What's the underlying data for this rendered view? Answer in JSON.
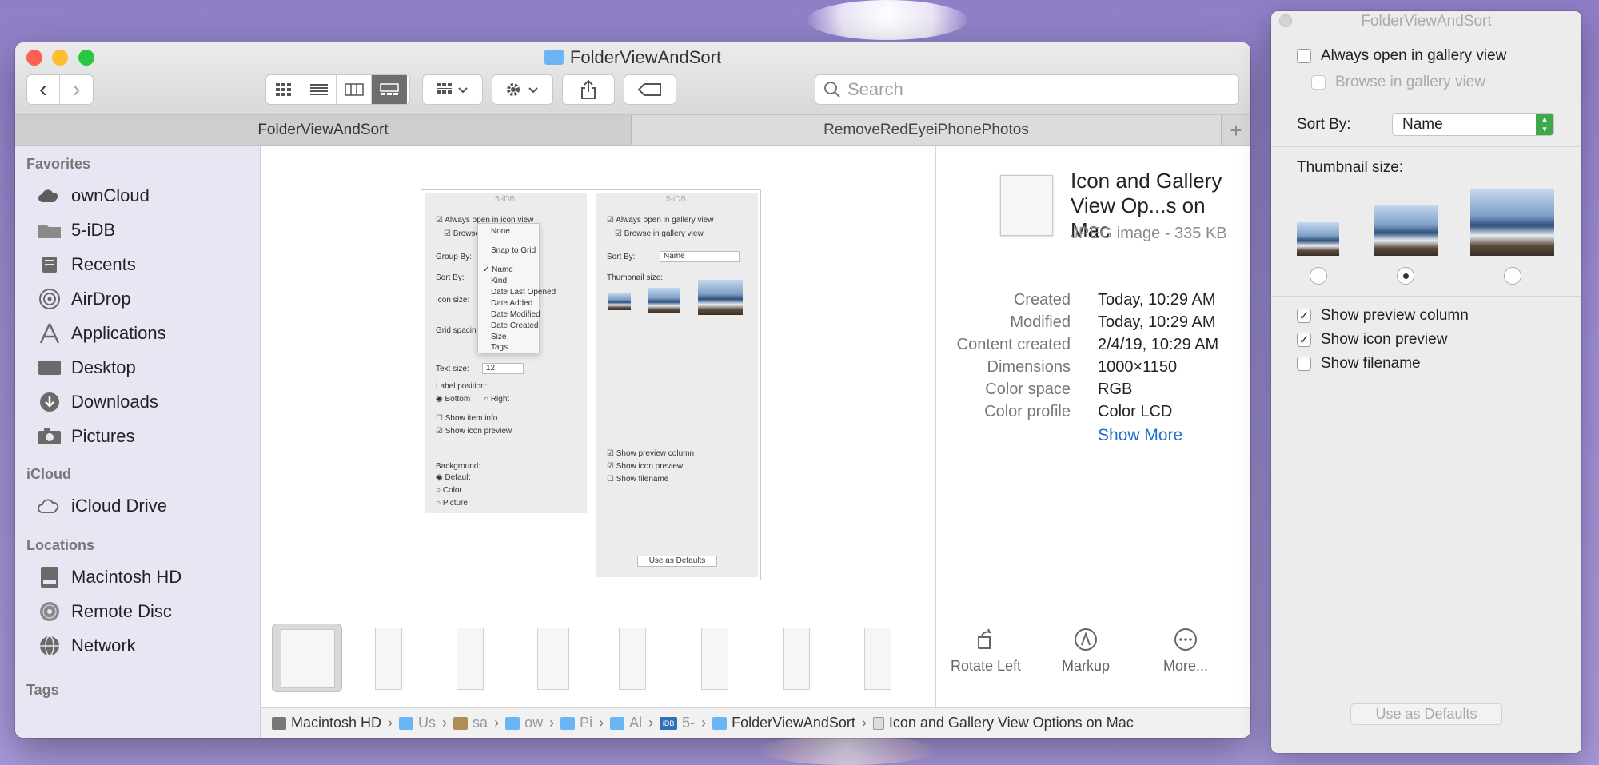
{
  "finder": {
    "title": "FolderViewAndSort",
    "search_placeholder": "Search",
    "tabs": [
      "FolderViewAndSort",
      "RemoveRedEyeiPhonePhotos"
    ],
    "add_tab": "+",
    "back": "‹",
    "forward": "›"
  },
  "sidebar": {
    "favorites_heading": "Favorites",
    "favorites": [
      {
        "label": "ownCloud",
        "icon": "cloud-icon"
      },
      {
        "label": "5-iDB",
        "icon": "folder-icon"
      },
      {
        "label": "Recents",
        "icon": "recents-icon"
      },
      {
        "label": "AirDrop",
        "icon": "airdrop-icon"
      },
      {
        "label": "Applications",
        "icon": "applications-icon"
      },
      {
        "label": "Desktop",
        "icon": "desktop-icon"
      },
      {
        "label": "Downloads",
        "icon": "downloads-icon"
      },
      {
        "label": "Pictures",
        "icon": "pictures-icon"
      }
    ],
    "icloud_heading": "iCloud",
    "icloud": [
      {
        "label": "iCloud Drive",
        "icon": "icloud-icon"
      }
    ],
    "locations_heading": "Locations",
    "locations": [
      {
        "label": "Macintosh HD",
        "icon": "disk-icon"
      },
      {
        "label": "Remote Disc",
        "icon": "disc-icon"
      },
      {
        "label": "Network",
        "icon": "network-icon"
      }
    ],
    "tags_heading": "Tags"
  },
  "preview_image": {
    "left_panel": {
      "title": "5-iDB",
      "always_open": "Always open in icon view",
      "browse": "Browse",
      "group_by": "Group By:",
      "sort_by": "Sort By:",
      "icon_size": "Icon size:",
      "grid_spacing": "Grid spacing",
      "text_size": "Text size:",
      "text_size_value": "12",
      "label_position": "Label position:",
      "bottom": "Bottom",
      "right": "Right",
      "show_item_info": "Show item info",
      "show_icon_preview": "Show icon preview",
      "background": "Background:",
      "bg_default": "Default",
      "bg_color": "Color",
      "bg_picture": "Picture"
    },
    "menu": [
      "None",
      "Snap to Grid",
      "Name",
      "Kind",
      "Date Last Opened",
      "Date Added",
      "Date Modified",
      "Date Created",
      "Size",
      "Tags"
    ],
    "right_panel": {
      "title": "5-iDB",
      "always_open": "Always open in gallery view",
      "browse": "Browse in gallery view",
      "sort_by": "Sort By:",
      "sort_value": "Name",
      "thumbnail_size": "Thumbnail size:",
      "show_preview_column": "Show preview column",
      "show_icon_preview": "Show icon preview",
      "show_filename": "Show filename",
      "use_as_defaults": "Use as Defaults"
    }
  },
  "preview": {
    "name": "Icon and Gallery View Op...s on Mac",
    "kind": "JPEG image - 335 KB",
    "info": [
      {
        "key": "Created",
        "value": "Today, 10:29 AM"
      },
      {
        "key": "Modified",
        "value": "Today, 10:29 AM"
      },
      {
        "key": "Content created",
        "value": "2/4/19, 10:29 AM"
      },
      {
        "key": "Dimensions",
        "value": "1000×1150"
      },
      {
        "key": "Color space",
        "value": "RGB"
      },
      {
        "key": "Color profile",
        "value": "Color LCD"
      }
    ],
    "show_more": "Show More",
    "actions": [
      "Rotate Left",
      "Markup",
      "More..."
    ]
  },
  "pathbar": [
    "Macintosh HD",
    "Us",
    "sa",
    "ow",
    "Pi",
    "Al",
    "5-",
    "FolderViewAndSort",
    "Icon and Gallery View Options on Mac"
  ],
  "pathbar_idb_badge": "iDB",
  "options_panel": {
    "title": "FolderViewAndSort",
    "always_open": "Always open in gallery view",
    "browse": "Browse in gallery view",
    "sort_by_label": "Sort By:",
    "sort_by_value": "Name",
    "thumbnail_size_label": "Thumbnail size:",
    "thumbnail_selected": "medium",
    "show_preview_column": "Show preview column",
    "show_icon_preview": "Show icon preview",
    "show_filename": "Show filename",
    "use_as_defaults": "Use as Defaults",
    "checked": {
      "always_open": false,
      "browse": false,
      "show_preview_column": true,
      "show_icon_preview": true,
      "show_filename": false
    }
  },
  "colors": {
    "accent": "#1a6fd1",
    "close": "#fd5f57",
    "minimize": "#febc2e",
    "zoom": "#28c840"
  }
}
